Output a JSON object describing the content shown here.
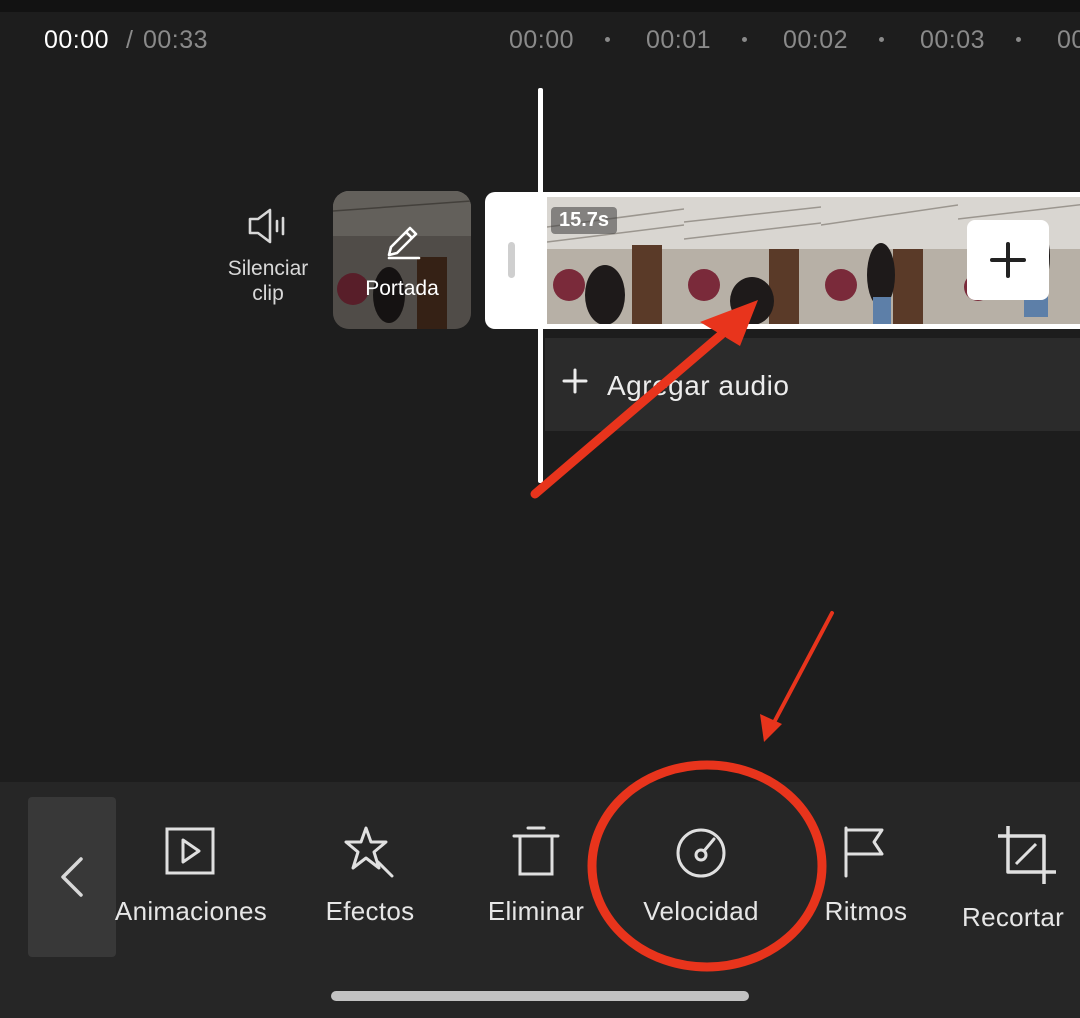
{
  "header": {
    "current_time": "00:00",
    "separator": "/",
    "total_time": "00:33"
  },
  "ruler": {
    "marks": [
      "00:00",
      "00:01",
      "00:02",
      "00:03",
      "00"
    ]
  },
  "timeline": {
    "mute_label": "Silenciar clip",
    "cover_label": "Portada",
    "clip_duration": "15.7s",
    "add_audio_label": "Agregar audio"
  },
  "toolbar": {
    "tools": [
      {
        "label": "Animaciones",
        "icon": "play-square-icon"
      },
      {
        "label": "Efectos",
        "icon": "magic-star-icon"
      },
      {
        "label": "Eliminar",
        "icon": "trash-icon"
      },
      {
        "label": "Velocidad",
        "icon": "speedometer-icon"
      },
      {
        "label": "Ritmos",
        "icon": "flag-icon"
      },
      {
        "label": "Recortar",
        "icon": "crop-icon"
      }
    ],
    "highlighted_tool": "Velocidad"
  },
  "colors": {
    "background": "#1d1d1d",
    "toolbar_background": "#262626",
    "annotation_red": "#e8341c",
    "clip_border": "#ffffff"
  }
}
